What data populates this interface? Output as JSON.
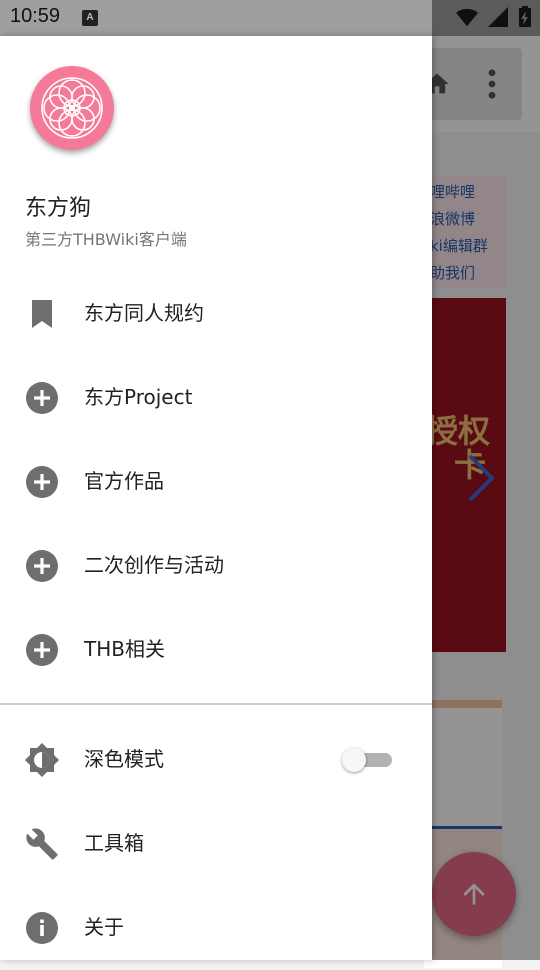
{
  "status_bar": {
    "time": "10:59",
    "notification_icon": "A"
  },
  "background": {
    "links": [
      "哩哔哩",
      "浪微博",
      "ki编辑群",
      "助我们"
    ],
    "banner_text": [
      "授权",
      "卡"
    ]
  },
  "drawer": {
    "app_name": "东方狗",
    "app_subtitle": "第三方THBWiki客户端",
    "items": [
      {
        "label": "东方同人规约",
        "icon": "bookmark-icon"
      },
      {
        "label": "东方Project",
        "icon": "plus-circle-icon"
      },
      {
        "label": "官方作品",
        "icon": "plus-circle-icon"
      },
      {
        "label": "二次创作与活动",
        "icon": "plus-circle-icon"
      },
      {
        "label": "THB相关",
        "icon": "plus-circle-icon"
      }
    ],
    "settings": [
      {
        "label": "深色模式",
        "icon": "brightness-icon",
        "toggle": false
      },
      {
        "label": "工具箱",
        "icon": "wrench-icon"
      },
      {
        "label": "关于",
        "icon": "info-icon"
      }
    ]
  },
  "colors": {
    "accent": "#f47a97",
    "icon_gray": "#6e6e6e",
    "link_blue": "#2a5db0"
  }
}
